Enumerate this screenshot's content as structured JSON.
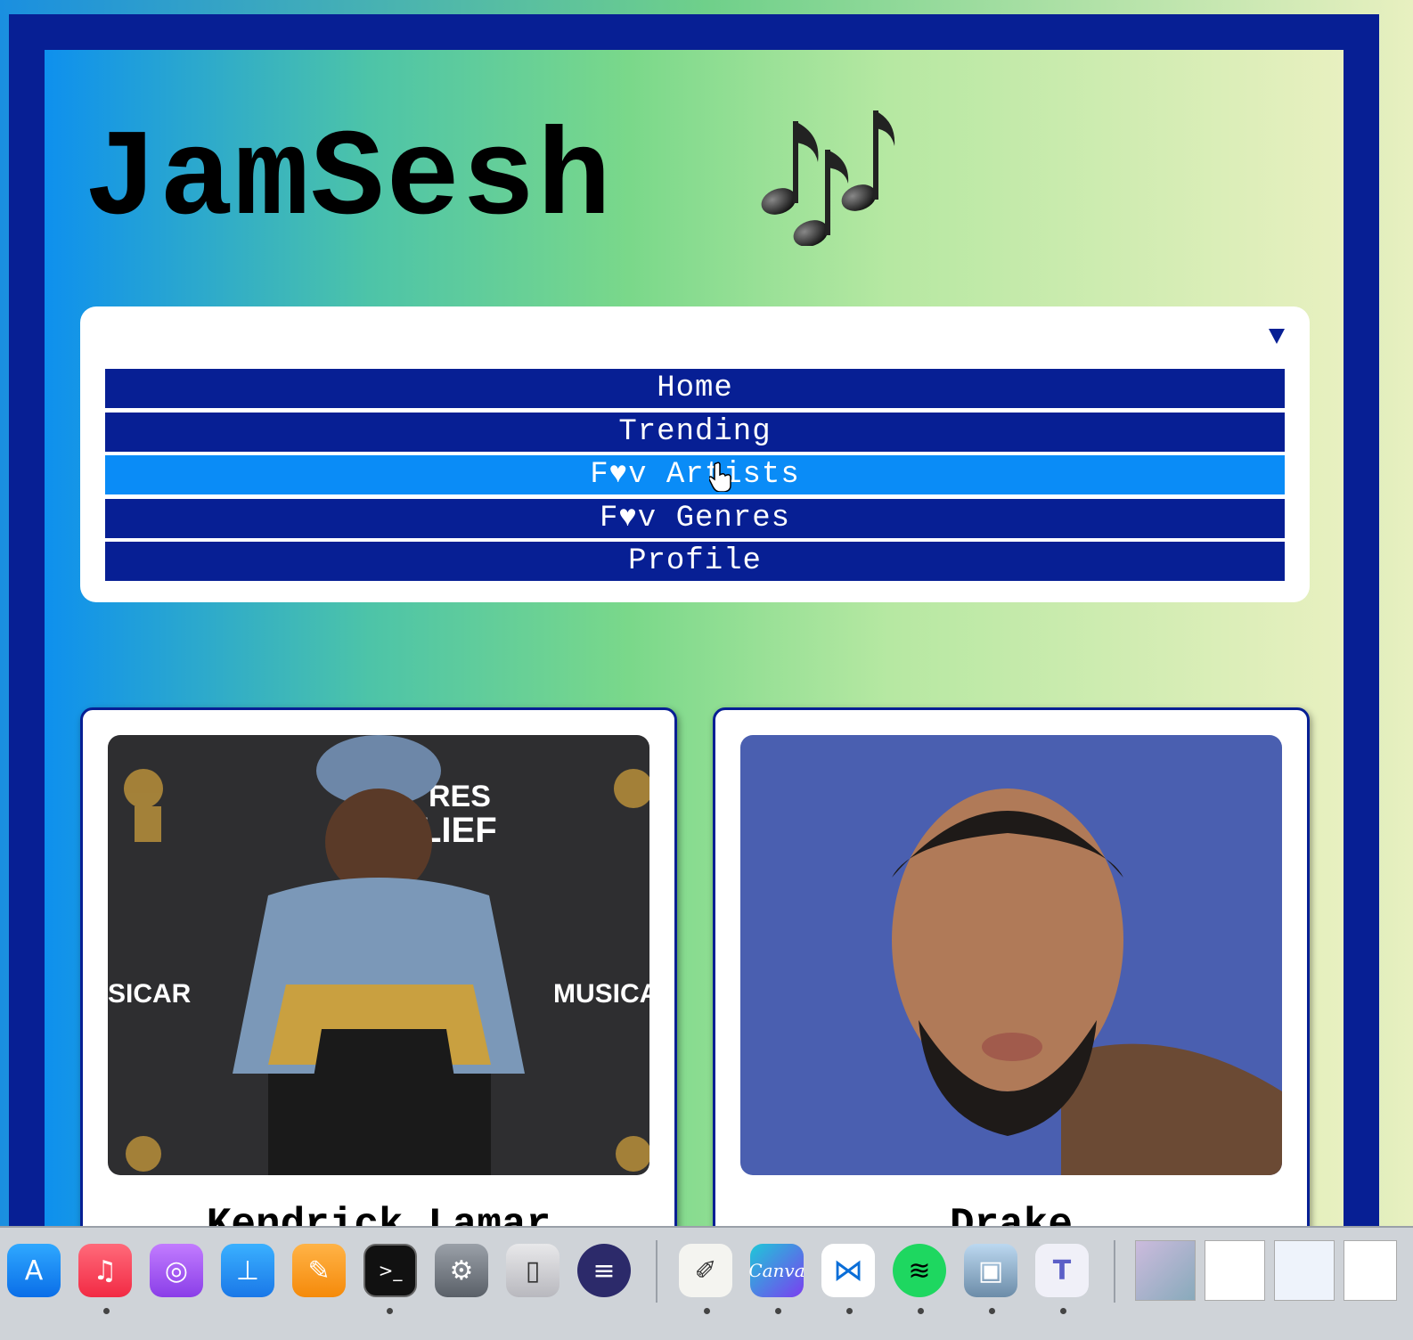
{
  "app": {
    "title": "JamSesh",
    "title_icon": "musical-notes-icon"
  },
  "menu": {
    "toggle_icon": "triangle-down-icon",
    "items": [
      {
        "label": "Home"
      },
      {
        "label": "Trending"
      },
      {
        "label": "F♥v Artists",
        "active": true
      },
      {
        "label": "F♥v Genres"
      },
      {
        "label": "Profile"
      }
    ]
  },
  "artists": [
    {
      "name": "Kendrick Lamar"
    },
    {
      "name": "Drake"
    }
  ],
  "colors": {
    "frame": "#071f94",
    "menu_item": "#071f94",
    "menu_item_active": "#0a8cf7"
  },
  "dock": {
    "apps": [
      {
        "name": "App Store",
        "icon": "app-store-icon"
      },
      {
        "name": "Music",
        "icon": "music-icon"
      },
      {
        "name": "Podcasts",
        "icon": "podcasts-icon"
      },
      {
        "name": "Keynote",
        "icon": "keynote-icon"
      },
      {
        "name": "Pages",
        "icon": "pages-icon"
      },
      {
        "name": "Terminal",
        "icon": "terminal-icon"
      },
      {
        "name": "System Settings",
        "icon": "settings-icon"
      },
      {
        "name": "iPhone Mirroring",
        "icon": "iphone-icon"
      },
      {
        "name": "Eclipse",
        "icon": "eclipse-icon"
      },
      {
        "name": "TextEdit",
        "icon": "textedit-icon"
      },
      {
        "name": "Canva",
        "icon": "canva-icon"
      },
      {
        "name": "Visual Studio Code",
        "icon": "vscode-icon"
      },
      {
        "name": "Spotify",
        "icon": "spotify-icon"
      },
      {
        "name": "Preview",
        "icon": "preview-icon"
      },
      {
        "name": "Microsoft Teams",
        "icon": "teams-icon"
      }
    ],
    "canva_label": "Canva"
  }
}
